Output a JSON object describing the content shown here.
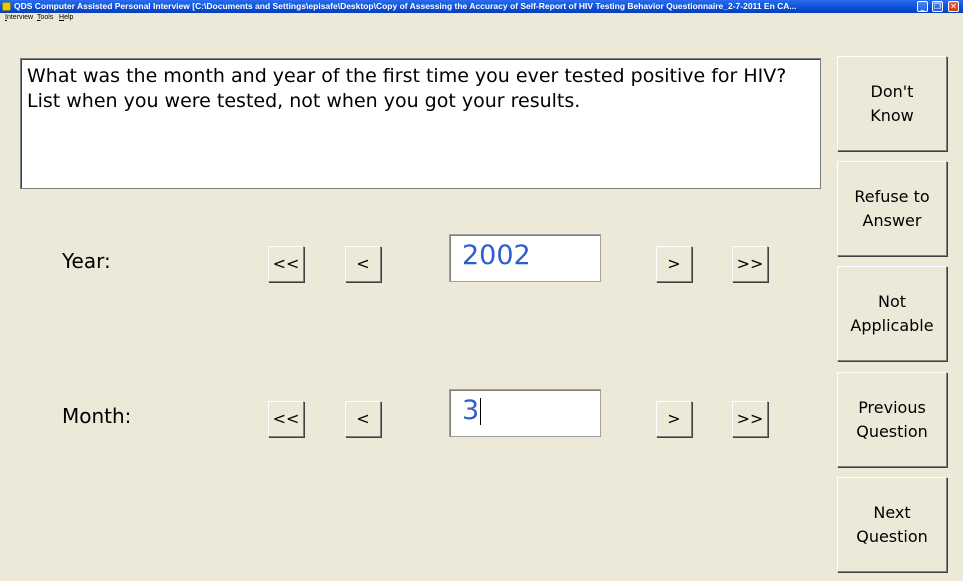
{
  "window": {
    "title": "QDS Computer Assisted Personal Interview [C:\\Documents and Settings\\episafe\\Desktop\\Copy of Assessing the Accuracy of Self-Report of HIV Testing Behavior Questionnaire_2-7-2011 En CA...",
    "minimize": "_",
    "maximize": "❐",
    "close": "✕"
  },
  "menu": [
    "Interview",
    "Tools",
    "Help"
  ],
  "question": "What was the month and year of the first time you ever tested positive for HIV? List when you were tested, not when you got your results.",
  "year": {
    "label": "Year:",
    "value": "2002",
    "first": "<<",
    "prev": "<",
    "next": ">",
    "last": ">>"
  },
  "month": {
    "label": "Month:",
    "value": "3",
    "first": "<<",
    "prev": "<",
    "next": ">",
    "last": ">>"
  },
  "side_buttons": {
    "dont_know": "Don't\nKnow",
    "refuse": "Refuse to\nAnswer",
    "not_applicable": "Not\nApplicable",
    "previous": "Previous\nQuestion",
    "next": "Next\nQuestion"
  },
  "colors": {
    "titlebar": "#0a4fd6",
    "background": "#ece9d8",
    "value_text": "#2a5fd0"
  }
}
